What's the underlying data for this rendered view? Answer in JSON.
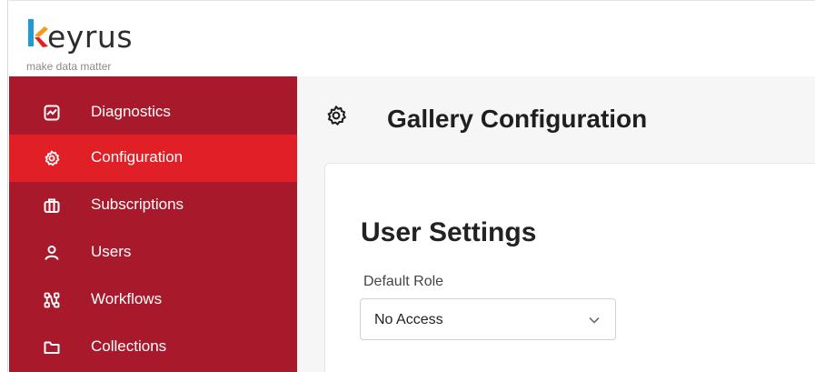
{
  "brand": {
    "name": "keyrus",
    "name_rest": "eyrus",
    "tagline": "make data matter"
  },
  "sidebar": {
    "items": [
      {
        "label": "Diagnostics",
        "icon": "chart-icon",
        "active": false
      },
      {
        "label": "Configuration",
        "icon": "gear-icon",
        "active": true
      },
      {
        "label": "Subscriptions",
        "icon": "briefcase-icon",
        "active": false
      },
      {
        "label": "Users",
        "icon": "user-icon",
        "active": false
      },
      {
        "label": "Workflows",
        "icon": "workflow-icon",
        "active": false
      },
      {
        "label": "Collections",
        "icon": "folder-icon",
        "active": false
      }
    ]
  },
  "main": {
    "page_title": "Gallery Configuration",
    "section_title": "User Settings",
    "default_role": {
      "label": "Default Role",
      "value": "No Access"
    }
  },
  "colors": {
    "sidebar_bg": "#a81a2b",
    "sidebar_active": "#e11f27",
    "logo_blue": "#1f9ad6",
    "logo_orange": "#f59c1a",
    "logo_red": "#e11f27"
  }
}
